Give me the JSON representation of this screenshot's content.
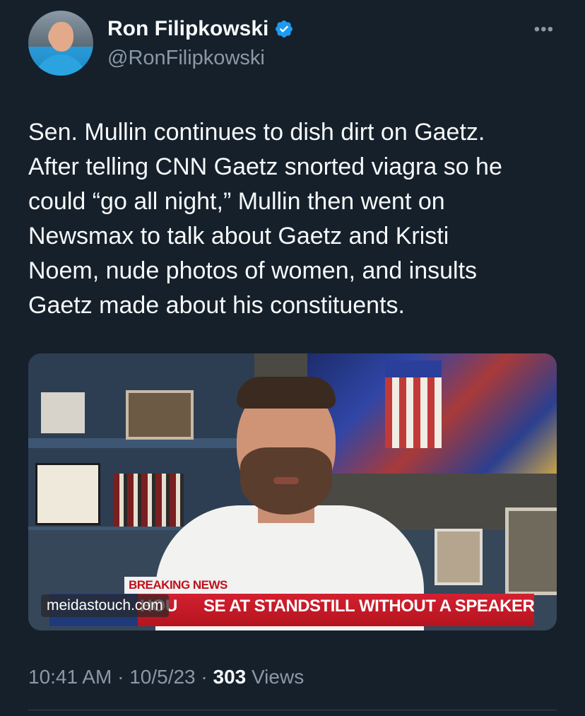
{
  "author": {
    "name": "Ron Filipkowski",
    "handle": "@RonFilipkowski",
    "verified": true
  },
  "more_icon": "•••",
  "tweet": {
    "text": "Sen. Mullin continues to dish dirt on Gaetz.\nAfter telling CNN Gaetz snorted viagra so he\ncould “go all night,” Mullin then went on\nNewsmax to talk about Gaetz and Kristi\nNoem, nude photos of women, and insults\nGaetz made about his constituents."
  },
  "media": {
    "breaking_label": "BREAKING NEWS",
    "headline_prefix": "HOU",
    "headline": "SE AT STANDSTILL WITHOUT A SPEAKER",
    "watermark": "meidastouch.com"
  },
  "meta": {
    "time": "10:41 AM",
    "date": "10/5/23",
    "views_count": "303",
    "views_label": "Views"
  },
  "colors": {
    "background": "#15202b",
    "primary_text": "#f7f9f9",
    "secondary_text": "#8b98a5",
    "verified_blue": "#1d9bf0"
  }
}
